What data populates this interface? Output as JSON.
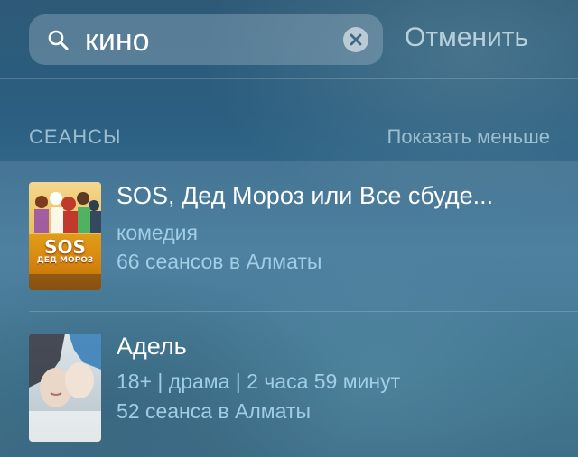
{
  "search": {
    "query": "кино",
    "cancel_label": "Отменить"
  },
  "section": {
    "title": "СЕАНСЫ",
    "action_label": "Показать меньше"
  },
  "results": [
    {
      "title": "SOS, Дед Мороз или Все сбуде...",
      "subtitle": "комедия",
      "sessions": "66 сеансов в Алматы",
      "poster_text": "SOS",
      "poster_subtext": "ДЕД МОРОЗ"
    },
    {
      "title": "Адель",
      "subtitle": "18+ | драма | 2 часа 59 минут",
      "sessions": "52 сеанса в Алматы"
    }
  ],
  "icons": {
    "search": "search-icon",
    "clear": "clear-icon"
  },
  "colors": {
    "accent_text": "#a5d2eb",
    "secondary_text": "#afcddc",
    "poster1_bg": "#e8a400"
  }
}
